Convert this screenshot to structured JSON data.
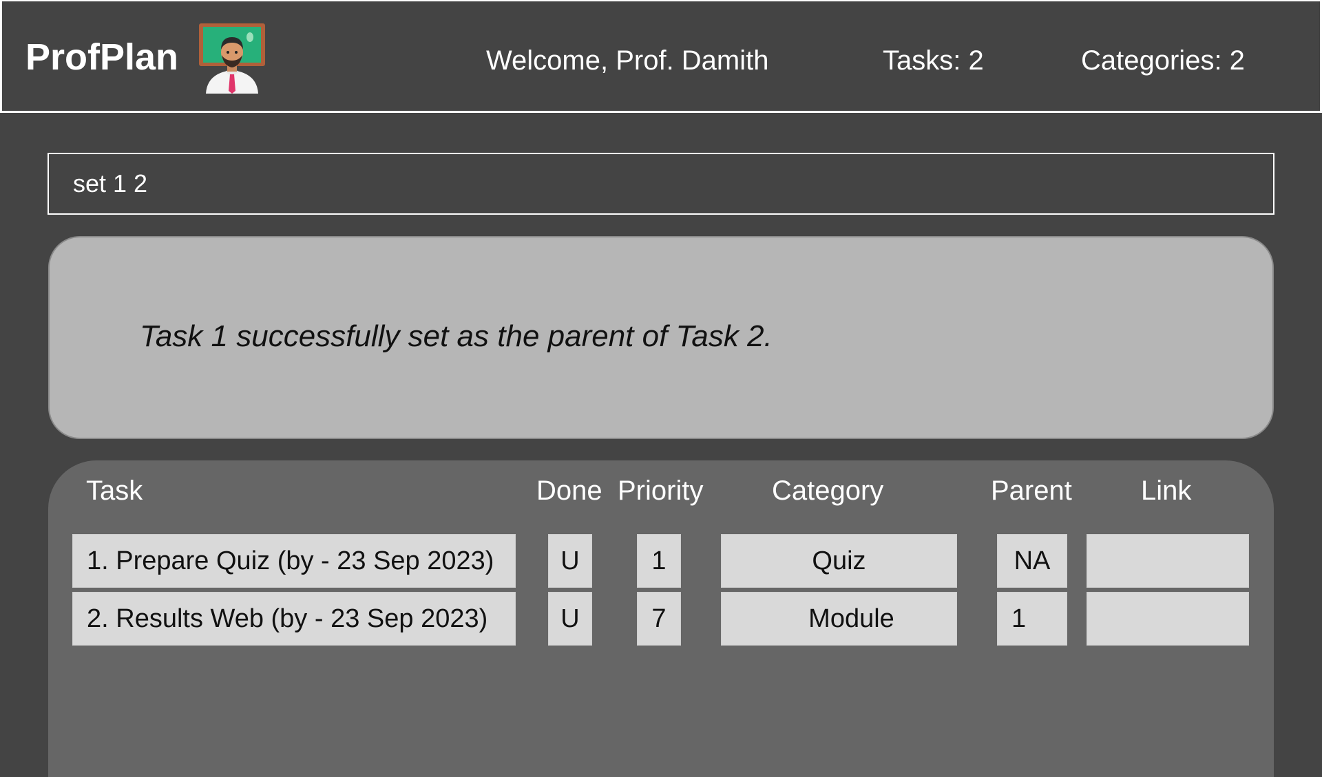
{
  "header": {
    "app_name": "ProfPlan",
    "avatar_icon": "professor-avatar-icon",
    "welcome": "Welcome, Prof. Damith",
    "tasks_count": "Tasks: 2",
    "categories_count": "Categories: 2"
  },
  "command": {
    "value": "set 1 2"
  },
  "result": {
    "message": "Task 1 successfully set as the parent of Task 2."
  },
  "table": {
    "columns": {
      "task": "Task",
      "done": "Done",
      "priority": "Priority",
      "category": "Category",
      "parent": "Parent",
      "link": "Link"
    },
    "rows": [
      {
        "task": "1. Prepare Quiz (by - 23 Sep 2023)",
        "done": "U",
        "priority": "1",
        "category": "Quiz",
        "parent": "NA",
        "link": ""
      },
      {
        "task": "2. Results Web (by - 23 Sep 2023)",
        "done": "U",
        "priority": "7",
        "category": "Module",
        "parent": "1",
        "link": ""
      }
    ]
  },
  "colors": {
    "background": "#444444",
    "result_box": "#b6b6b6",
    "table_panel": "#666666",
    "cell": "#d9d9d9"
  }
}
